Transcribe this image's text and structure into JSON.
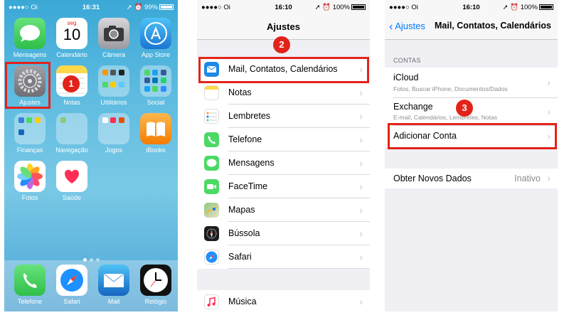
{
  "home": {
    "status": {
      "carrier": "●●●●○ Oi ",
      "time": "16:31",
      "battery": "99%"
    },
    "apps": [
      {
        "label": "Mensagens"
      },
      {
        "label": "Calendário",
        "weekday": "seg",
        "day": "10"
      },
      {
        "label": "Câmera"
      },
      {
        "label": "App Store"
      },
      {
        "label": "Ajustes"
      },
      {
        "label": "Notas"
      },
      {
        "label": "Utilitários"
      },
      {
        "label": "Social"
      },
      {
        "label": "Finanças"
      },
      {
        "label": "Navegação"
      },
      {
        "label": "Jogos"
      },
      {
        "label": "iBooks"
      },
      {
        "label": "Fotos"
      },
      {
        "label": "Saúde"
      }
    ],
    "dock": [
      {
        "label": "Telefone"
      },
      {
        "label": "Safari"
      },
      {
        "label": "Mail"
      },
      {
        "label": "Relógio"
      }
    ],
    "step": "1"
  },
  "settings": {
    "status": {
      "carrier": "●●●●○ Oi ",
      "time": "16:10",
      "battery": "100%"
    },
    "title": "Ajustes",
    "step": "2",
    "items": [
      {
        "label": "Mail, Contatos, Calendários",
        "icon": "mail-icon",
        "color": "#1e88e5"
      },
      {
        "label": "Notas",
        "icon": "notes-icon",
        "color": "#fcd84a"
      },
      {
        "label": "Lembretes",
        "icon": "reminders-icon",
        "color": "#ffffff"
      },
      {
        "label": "Telefone",
        "icon": "phone-icon",
        "color": "#4cd964"
      },
      {
        "label": "Mensagens",
        "icon": "messages-icon",
        "color": "#4cd964"
      },
      {
        "label": "FaceTime",
        "icon": "facetime-icon",
        "color": "#4cd964"
      },
      {
        "label": "Mapas",
        "icon": "maps-icon",
        "color": "#8fc97a"
      },
      {
        "label": "Bússola",
        "icon": "compass-icon",
        "color": "#1c1c1e"
      },
      {
        "label": "Safari",
        "icon": "safari-icon",
        "color": "#1e90ff"
      },
      {
        "label": "Música",
        "icon": "music-icon",
        "color": "#ffffff"
      }
    ]
  },
  "mail": {
    "status": {
      "carrier": "●●●●○ Oi ",
      "time": "16:10",
      "battery": "100%"
    },
    "back": "Ajustes",
    "title": "Mail, Contatos, Calendários",
    "section": "CONTAS",
    "accounts": [
      {
        "title": "iCloud",
        "subtitle": "Fotos, Buscar iPhone, Documentos/Dados"
      },
      {
        "title": "Exchange",
        "subtitle": "E-mail, Calendários, Lembretes, Notas"
      }
    ],
    "add_account": "Adicionar Conta",
    "fetch_label": "Obter Novos Dados",
    "fetch_value": "Inativo",
    "step": "3"
  }
}
